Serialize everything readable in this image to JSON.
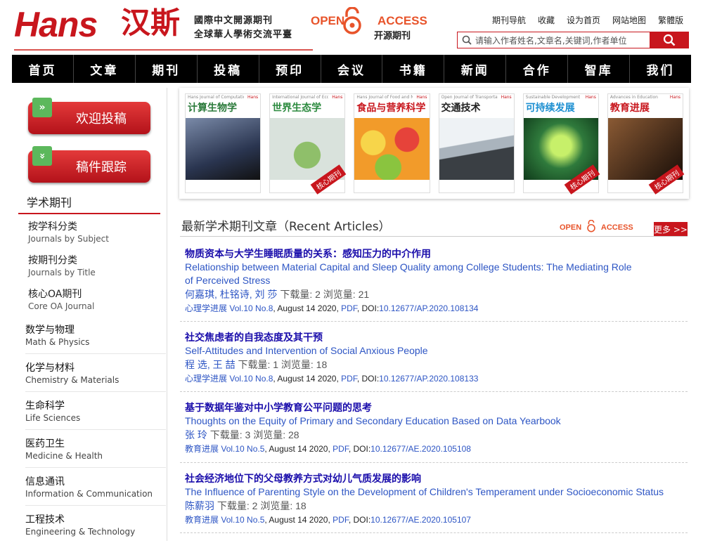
{
  "header": {
    "logo": "Hans",
    "logo_cn": "汉斯",
    "slogan1": "國際中文開源期刊",
    "slogan2": "全球華人學術交流平臺",
    "oa_left": "OPEN",
    "oa_right": "ACCESS",
    "oa_sub": "开源期刊",
    "links": [
      "期刊导航",
      "收藏",
      "设为首页",
      "网站地图",
      "繁體版"
    ],
    "search_placeholder": "请输入作者姓名,文章名,关键词,作者单位"
  },
  "nav": [
    "首页",
    "文章",
    "期刊",
    "投稿",
    "预印",
    "会议",
    "书籍",
    "新闻",
    "合作",
    "智库",
    "我们"
  ],
  "sidebar": {
    "btn_submit": "欢迎投稿",
    "btn_track": "稿件跟踪",
    "section_title": "学术期刊",
    "sub": [
      {
        "zh": "按学科分类",
        "en": "Journals by Subject"
      },
      {
        "zh": "按期刊分类",
        "en": "Journals by Title"
      },
      {
        "zh": "核心OA期刊",
        "en": "Core OA Journal"
      }
    ],
    "cats": [
      {
        "zh": "数学与物理",
        "en": "Math & Physics"
      },
      {
        "zh": "化学与材料",
        "en": "Chemistry & Materials"
      },
      {
        "zh": "生命科学",
        "en": "Life Sciences"
      },
      {
        "zh": "医药卫生",
        "en": "Medicine & Health"
      },
      {
        "zh": "信息通讯",
        "en": "Information & Communication"
      },
      {
        "zh": "工程技术",
        "en": "Engineering & Technology"
      }
    ]
  },
  "covers": [
    {
      "title": "计算生物学",
      "sub": "Hans Journal of Computational Biology",
      "color": "#3a4a6a",
      "tc": "#2a7a3a",
      "badge": ""
    },
    {
      "title": "世界生态学",
      "sub": "International Journal of Ecology",
      "color": "#cfd8d3",
      "tc": "#2b8a3e",
      "badge": "核心期刊"
    },
    {
      "title": "食品与营养科学",
      "sub": "Hans Journal of Food and Nutrition Science",
      "color": "#f2a800",
      "tc": "#c8161d",
      "badge": ""
    },
    {
      "title": "交通技术",
      "sub": "Open Journal of Transportation Technologies",
      "color": "#6a7f94",
      "tc": "#222",
      "badge": ""
    },
    {
      "title": "可持续发展",
      "sub": "Sustainable Development",
      "color": "#2f7a3c",
      "tc": "#1c8fd1",
      "badge": "核心期刊"
    },
    {
      "title": "教育进展",
      "sub": "Advances in Education",
      "color": "#5a3a24",
      "tc": "#c8161d",
      "badge": "核心期刊"
    }
  ],
  "recent": {
    "title": "最新学术期刊文章（Recent Articles）",
    "oa_left": "OPEN",
    "oa_right": "ACCESS",
    "more": "更多 >>",
    "articles": [
      {
        "zh": "物质资本与大学生睡眠质量的关系：感知压力的中介作用",
        "en": "Relationship between Material Capital and Sleep Quality among College Students: The Mediating Role of Perceived Stress",
        "authors": "何嘉琪, 杜铭诗, 刘 莎",
        "stats": "下载量: 2  浏览量: 21",
        "journal": "心理学进展",
        "vol": "Vol.10 No.8",
        "date": ", August 14 2020, ",
        "pdf": "PDF",
        "doi_label": ", DOI:",
        "doi": "10.12677/AP.2020.108134"
      },
      {
        "zh": "社交焦虑者的自我态度及其干预",
        "en": "Self-Attitudes and Intervention of Social Anxious People",
        "authors": "程 选, 王 喆",
        "stats": "下载量: 1  浏览量: 18",
        "journal": "心理学进展",
        "vol": "Vol.10 No.8",
        "date": ", August 14 2020, ",
        "pdf": "PDF",
        "doi_label": ", DOI:",
        "doi": "10.12677/AP.2020.108133"
      },
      {
        "zh": "基于数据年鉴对中小学教育公平问题的思考",
        "en": "Thoughts on the Equity of Primary and Secondary Education Based on Data Yearbook",
        "authors": "张 玲",
        "stats": "下载量: 3  浏览量: 28",
        "journal": "教育进展",
        "vol": "Vol.10 No.5",
        "date": ", August 14 2020, ",
        "pdf": "PDF",
        "doi_label": ", DOI:",
        "doi": "10.12677/AE.2020.105108"
      },
      {
        "zh": "社会经济地位下的父母教养方式对幼儿气质发展的影响",
        "en": "The Influence of Parenting Style on the Development of Children's Temperament under Socioeconomic Status",
        "authors": "陈薪羽",
        "stats": "下载量: 2  浏览量: 18",
        "journal": "教育进展",
        "vol": "Vol.10 No.5",
        "date": ", August 14 2020, ",
        "pdf": "PDF",
        "doi_label": ", DOI:",
        "doi": "10.12677/AE.2020.105107"
      }
    ]
  },
  "colors": {
    "brand": "#c8161d",
    "link": "#2d55c4",
    "nav": "#000000"
  }
}
